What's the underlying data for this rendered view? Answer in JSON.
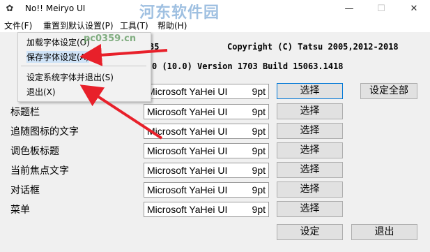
{
  "window": {
    "title": "No!! Meiryo UI",
    "controls": {
      "minimize": "—",
      "maximize": "☐",
      "close": "✕"
    }
  },
  "menu": {
    "items": [
      "文件(F)",
      "重置到默认设置(P)",
      "工具(T)",
      "帮助(H)"
    ]
  },
  "file_menu": {
    "items": [
      "加载字体设定(O)",
      "保存字体设定(A)",
      "设定系统字体并退出(S)",
      "退出(X)"
    ]
  },
  "watermark": {
    "text": "河东软件园",
    "url": "pc0359.cn"
  },
  "info": {
    "version_prefix": "35",
    "copyright": "Copyright (C) Tatsu 2005,2012-2018",
    "os_version": "0 (10.0) Version 1703 Build 15063.1418"
  },
  "rows": [
    {
      "label": "",
      "font": "Microsoft YaHei UI",
      "size": "9pt",
      "button": "选择"
    },
    {
      "label": "标题栏",
      "font": "Microsoft YaHei UI",
      "size": "9pt",
      "button": "选择"
    },
    {
      "label": "追随图标的文字",
      "font": "Microsoft YaHei UI",
      "size": "9pt",
      "button": "选择"
    },
    {
      "label": "调色板标题",
      "font": "Microsoft YaHei UI",
      "size": "9pt",
      "button": "选择"
    },
    {
      "label": "当前焦点文字",
      "font": "Microsoft YaHei UI",
      "size": "9pt",
      "button": "选择"
    },
    {
      "label": "对话框",
      "font": "Microsoft YaHei UI",
      "size": "9pt",
      "button": "选择"
    },
    {
      "label": "菜单",
      "font": "Microsoft YaHei UI",
      "size": "9pt",
      "button": "选择"
    }
  ],
  "buttons": {
    "set_all": "设定全部",
    "apply": "设定",
    "exit": "退出"
  },
  "colors": {
    "arrow": "#e8202a",
    "button_focus": "#0078d7"
  }
}
